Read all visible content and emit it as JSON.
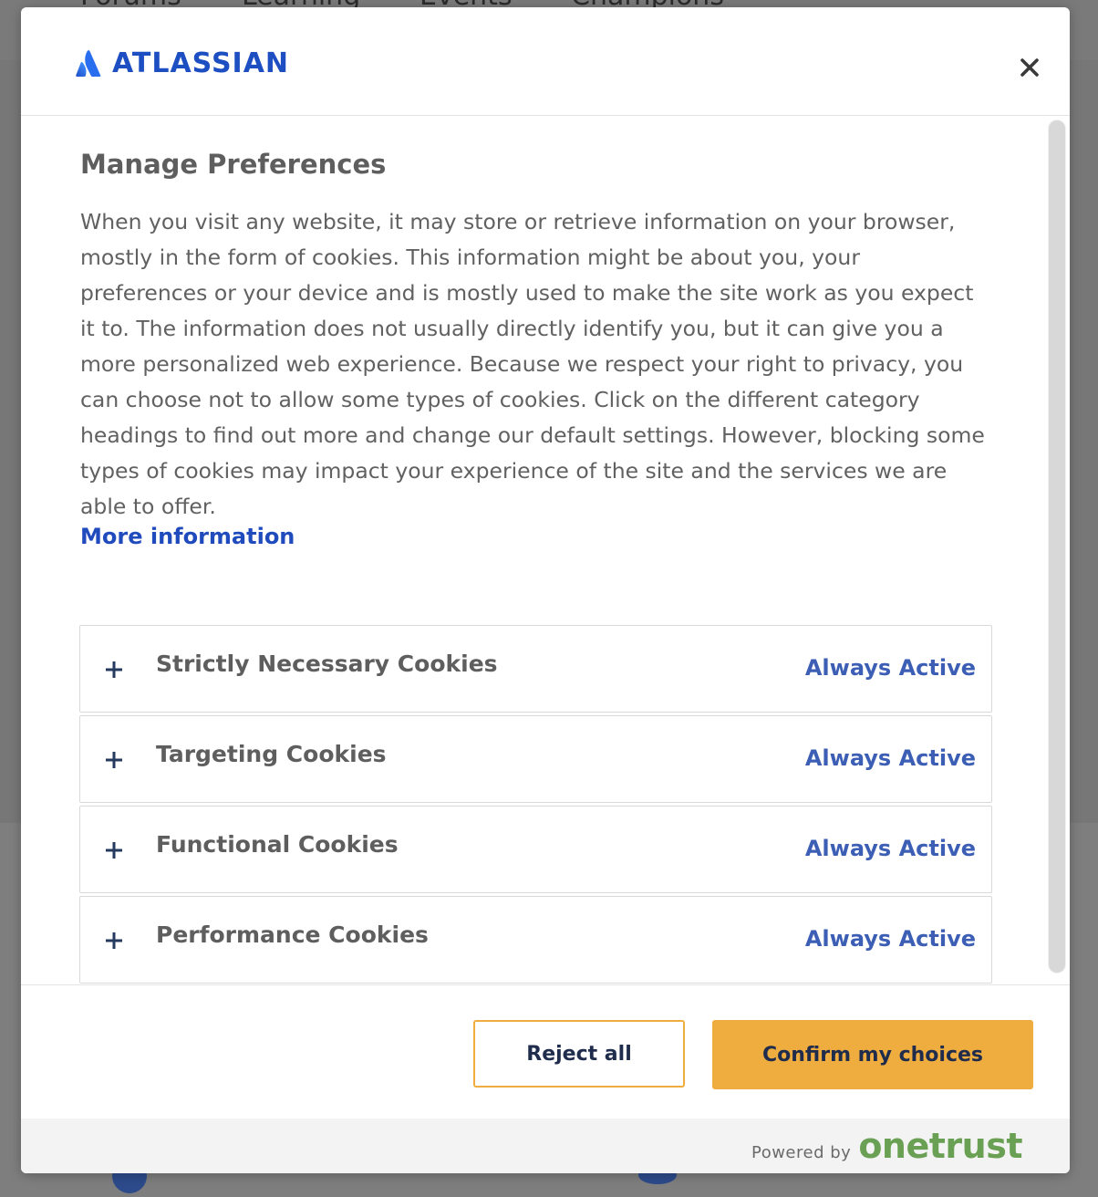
{
  "background": {
    "nav_items": [
      "Forums",
      "Learning",
      "Events",
      "Champions"
    ]
  },
  "modal": {
    "brand": "ATLASSIAN",
    "close_icon": "close-icon",
    "title": "Manage Preferences",
    "description": "When you visit any website, it may store or retrieve information on your browser, mostly in the form of cookies. This information might be about you, your preferences or your device and is mostly used to make the site work as you expect it to. The information does not usually directly identify you, but it can give you a more personalized web experience. Because we respect your right to privacy, you can choose not to allow some types of cookies. Click on the different category headings to find out more and change our default settings. However, blocking some types of cookies may impact your experience of the site and the services we are able to offer.",
    "more_info_label": "More information",
    "categories": [
      {
        "label": "Strictly Necessary Cookies",
        "status": "Always Active",
        "icon": "plus-icon"
      },
      {
        "label": "Targeting Cookies",
        "status": "Always Active",
        "icon": "plus-icon"
      },
      {
        "label": "Functional Cookies",
        "status": "Always Active",
        "icon": "plus-icon"
      },
      {
        "label": "Performance Cookies",
        "status": "Always Active",
        "icon": "plus-icon"
      }
    ],
    "buttons": {
      "reject_label": "Reject all",
      "confirm_label": "Confirm my choices"
    },
    "footer": {
      "powered_by": "Powered by",
      "vendor": "onetrust"
    }
  },
  "colors": {
    "brand_blue": "#1e4fc2",
    "link_blue": "#1f4bbd",
    "status_blue": "#3c5fb5",
    "accent_orange": "#f0ad3f",
    "onetrust_green": "#6aa053",
    "overlay_gray": "#7c7c7c"
  }
}
